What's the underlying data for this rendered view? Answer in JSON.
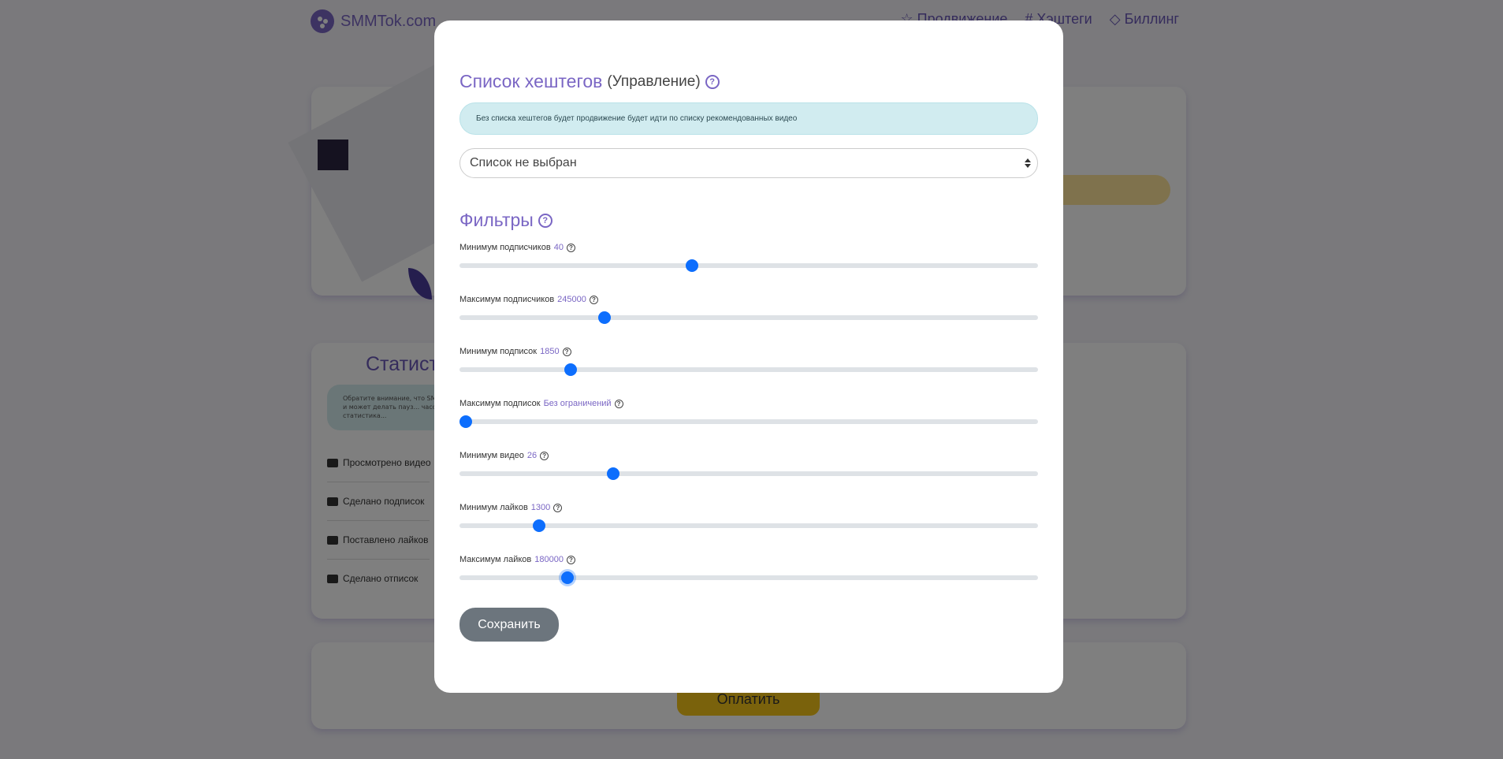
{
  "nav": {
    "brand": "SMMTok.com",
    "links": [
      {
        "label": "Продвижение",
        "icon": "star-icon"
      },
      {
        "label": "Хэштеги",
        "icon": "hash-icon"
      },
      {
        "label": "Биллинг",
        "icon": "diamond-icon"
      }
    ]
  },
  "background": {
    "stats_title": "Статист",
    "stats_info": "Обратите внимание, что SMM... человека и может делать пауз... часов. В это время статистика...",
    "stats_rows": [
      "Просмотрено видео",
      "Сделано подписок",
      "Поставлено лайков",
      "Сделано отписок"
    ],
    "pay_button": "Оплатить"
  },
  "modal": {
    "hashtags": {
      "title": "Список хештегов",
      "subtitle": "(Управление)",
      "alert": "Без списка хештегов будет продвижение будет идти по списку рекомендованных видео",
      "select_value": "Список не выбран"
    },
    "filters": {
      "title": "Фильтры",
      "items": [
        {
          "label": "Минимум подписчиков",
          "value": "40",
          "fraction": 0.4
        },
        {
          "label": "Максимум подписчиков",
          "value": "245000",
          "fraction": 0.245
        },
        {
          "label": "Минимум подписок",
          "value": "1850",
          "fraction": 0.185
        },
        {
          "label": "Максимум подписок",
          "value": "Без ограничений",
          "fraction": 0.0
        },
        {
          "label": "Минимум видео",
          "value": "26",
          "fraction": 0.26
        },
        {
          "label": "Минимум лайков",
          "value": "1300",
          "fraction": 0.13
        },
        {
          "label": "Максимум лайков",
          "value": "180000",
          "fraction": 0.18
        }
      ]
    },
    "save_button": "Сохранить"
  },
  "colors": {
    "accent": "#7a66c4",
    "slider_thumb": "#0d6efd",
    "backdrop": "rgba(0,0,0,0.5)"
  }
}
